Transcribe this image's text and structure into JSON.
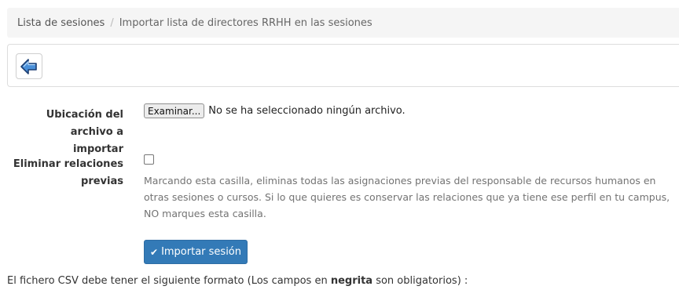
{
  "breadcrumb": {
    "items": [
      "Lista de sesiones",
      "Importar lista de directores RRHH en las sesiones"
    ],
    "separator": "/"
  },
  "toolbar": {
    "back_icon": "arrow-left-icon"
  },
  "form": {
    "file_label": "Ubicación del archivo a importar",
    "file_label_line1": "Ubicación del archivo a",
    "file_label_line2": "importar",
    "browse_button": "Examinar...",
    "file_status": "No se ha seleccionado ningún archivo.",
    "remove_label_line1": "Eliminar relaciones",
    "remove_label_line2": "previas",
    "remove_checked": false,
    "remove_help": "Marcando esta casilla, eliminas todas las asignaciones previas del responsable de recursos humanos en otras sesiones o cursos. Si lo que quieres es conservar las relaciones que ya tiene ese perfil en tu campus, NO marques esta casilla.",
    "submit_label": "Importar sesión",
    "submit_icon": "check-icon"
  },
  "csv_note": {
    "prefix": "El fichero CSV debe tener el siguiente formato (Los campos en ",
    "bold": "negrita",
    "suffix": " son obligatorios) :"
  },
  "colors": {
    "primary": "#337ab7",
    "breadcrumb_bg": "#f5f5f5",
    "help_text": "#737373"
  }
}
